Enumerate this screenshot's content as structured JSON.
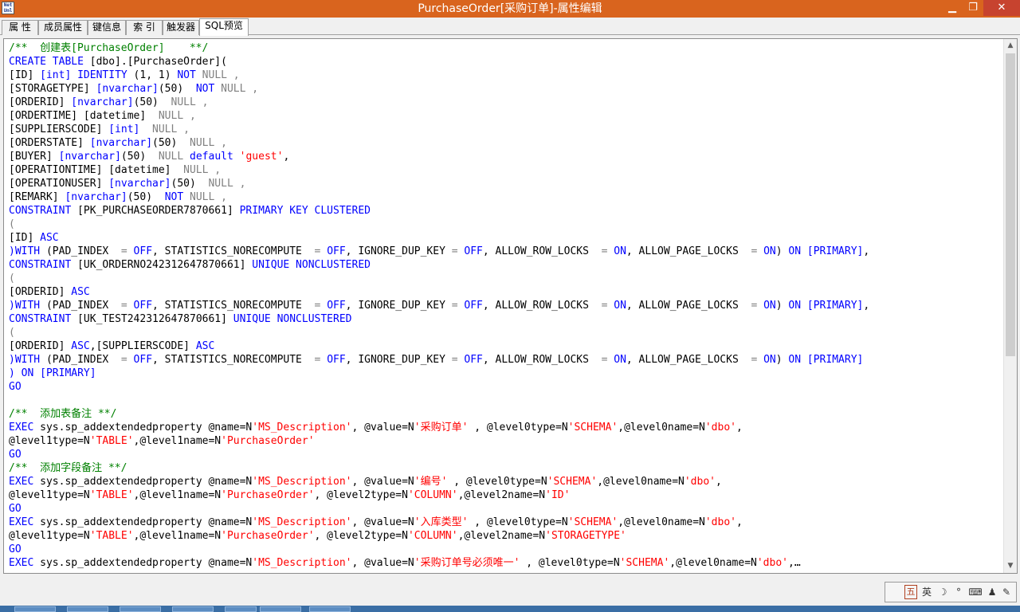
{
  "window": {
    "title": "PurchaseOrder[采购订单]-属性编辑",
    "app_icon_text": "Net Uml",
    "minimize_glyph": "▁",
    "maximize_glyph": "❐",
    "close_glyph": "✕"
  },
  "tabs": [
    {
      "label": "属 性"
    },
    {
      "label": "成员属性"
    },
    {
      "label": "键信息"
    },
    {
      "label": "索 引"
    },
    {
      "label": "触发器"
    },
    {
      "label": "SQL预览",
      "active": true
    }
  ],
  "colors": {
    "titlebar": "#d9641e",
    "comment": "#008000",
    "keyword": "#0000ff",
    "null_gray": "#808080",
    "string": "#ff0000"
  },
  "editor": {
    "lines": [
      [
        [
          "c",
          "/**  创建表[PurchaseOrder]    **/"
        ]
      ],
      [
        [
          "k",
          "CREATE TABLE"
        ],
        [
          "p",
          " [dbo].[PurchaseOrder]("
        ]
      ],
      [
        [
          "p",
          "[ID] "
        ],
        [
          "k",
          "[int]"
        ],
        [
          "p",
          " "
        ],
        [
          "k",
          "IDENTITY"
        ],
        [
          "p",
          " (1, 1) "
        ],
        [
          "k",
          "NOT"
        ],
        [
          "p",
          " "
        ],
        [
          "g",
          "NULL ,"
        ]
      ],
      [
        [
          "p",
          "[STORAGETYPE] "
        ],
        [
          "k",
          "[nvarchar]"
        ],
        [
          "p",
          "(50)  "
        ],
        [
          "k",
          "NOT"
        ],
        [
          "p",
          " "
        ],
        [
          "g",
          "NULL ,"
        ]
      ],
      [
        [
          "p",
          "[ORDERID] "
        ],
        [
          "k",
          "[nvarchar]"
        ],
        [
          "p",
          "(50)  "
        ],
        [
          "g",
          "NULL ,"
        ]
      ],
      [
        [
          "p",
          "[ORDERTIME] [datetime]  "
        ],
        [
          "g",
          "NULL ,"
        ]
      ],
      [
        [
          "p",
          "[SUPPLIERSCODE] "
        ],
        [
          "k",
          "[int]"
        ],
        [
          "p",
          "  "
        ],
        [
          "g",
          "NULL ,"
        ]
      ],
      [
        [
          "p",
          "[ORDERSTATE] "
        ],
        [
          "k",
          "[nvarchar]"
        ],
        [
          "p",
          "(50)  "
        ],
        [
          "g",
          "NULL ,"
        ]
      ],
      [
        [
          "p",
          "[BUYER] "
        ],
        [
          "k",
          "[nvarchar]"
        ],
        [
          "p",
          "(50)  "
        ],
        [
          "g",
          "NULL"
        ],
        [
          "p",
          " "
        ],
        [
          "k",
          "default"
        ],
        [
          "p",
          " "
        ],
        [
          "s",
          "'guest'"
        ],
        [
          "p",
          ","
        ]
      ],
      [
        [
          "p",
          "[OPERATIONTIME] [datetime]  "
        ],
        [
          "g",
          "NULL ,"
        ]
      ],
      [
        [
          "p",
          "[OPERATIONUSER] "
        ],
        [
          "k",
          "[nvarchar]"
        ],
        [
          "p",
          "(50)  "
        ],
        [
          "g",
          "NULL ,"
        ]
      ],
      [
        [
          "p",
          "[REMARK] "
        ],
        [
          "k",
          "[nvarchar]"
        ],
        [
          "p",
          "(50)  "
        ],
        [
          "k",
          "NOT"
        ],
        [
          "p",
          " "
        ],
        [
          "g",
          "NULL ,"
        ]
      ],
      [
        [
          "k",
          "CONSTRAINT"
        ],
        [
          "p",
          " [PK_PURCHASEORDER7870661] "
        ],
        [
          "k",
          "PRIMARY KEY CLUSTERED"
        ]
      ],
      [
        [
          "g",
          "("
        ]
      ],
      [
        [
          "p",
          "[ID] "
        ],
        [
          "k",
          "ASC"
        ]
      ],
      [
        [
          "k",
          ")WITH"
        ],
        [
          "p",
          " (PAD_INDEX  "
        ],
        [
          "g",
          "="
        ],
        [
          "p",
          " "
        ],
        [
          "k",
          "OFF"
        ],
        [
          "p",
          ", STATISTICS_NORECOMPUTE  "
        ],
        [
          "g",
          "="
        ],
        [
          "p",
          " "
        ],
        [
          "k",
          "OFF"
        ],
        [
          "p",
          ", IGNORE_DUP_KEY "
        ],
        [
          "g",
          "="
        ],
        [
          "p",
          " "
        ],
        [
          "k",
          "OFF"
        ],
        [
          "p",
          ", ALLOW_ROW_LOCKS  "
        ],
        [
          "g",
          "="
        ],
        [
          "p",
          " "
        ],
        [
          "k",
          "ON"
        ],
        [
          "p",
          ", ALLOW_PAGE_LOCKS  "
        ],
        [
          "g",
          "="
        ],
        [
          "p",
          " "
        ],
        [
          "k",
          "ON"
        ],
        [
          "p",
          ") "
        ],
        [
          "k",
          "ON"
        ],
        [
          "p",
          " "
        ],
        [
          "k",
          "[PRIMARY]"
        ],
        [
          "p",
          ","
        ]
      ],
      [
        [
          "k",
          "CONSTRAINT"
        ],
        [
          "p",
          " [UK_ORDERNO242312647870661] "
        ],
        [
          "k",
          "UNIQUE NONCLUSTERED"
        ]
      ],
      [
        [
          "g",
          "("
        ]
      ],
      [
        [
          "p",
          "[ORDERID] "
        ],
        [
          "k",
          "ASC"
        ]
      ],
      [
        [
          "k",
          ")WITH"
        ],
        [
          "p",
          " (PAD_INDEX  "
        ],
        [
          "g",
          "="
        ],
        [
          "p",
          " "
        ],
        [
          "k",
          "OFF"
        ],
        [
          "p",
          ", STATISTICS_NORECOMPUTE  "
        ],
        [
          "g",
          "="
        ],
        [
          "p",
          " "
        ],
        [
          "k",
          "OFF"
        ],
        [
          "p",
          ", IGNORE_DUP_KEY "
        ],
        [
          "g",
          "="
        ],
        [
          "p",
          " "
        ],
        [
          "k",
          "OFF"
        ],
        [
          "p",
          ", ALLOW_ROW_LOCKS  "
        ],
        [
          "g",
          "="
        ],
        [
          "p",
          " "
        ],
        [
          "k",
          "ON"
        ],
        [
          "p",
          ", ALLOW_PAGE_LOCKS  "
        ],
        [
          "g",
          "="
        ],
        [
          "p",
          " "
        ],
        [
          "k",
          "ON"
        ],
        [
          "p",
          ") "
        ],
        [
          "k",
          "ON"
        ],
        [
          "p",
          " "
        ],
        [
          "k",
          "[PRIMARY]"
        ],
        [
          "p",
          ","
        ]
      ],
      [
        [
          "k",
          "CONSTRAINT"
        ],
        [
          "p",
          " [UK_TEST242312647870661] "
        ],
        [
          "k",
          "UNIQUE NONCLUSTERED"
        ]
      ],
      [
        [
          "g",
          "("
        ]
      ],
      [
        [
          "p",
          "[ORDERID] "
        ],
        [
          "k",
          "ASC"
        ],
        [
          "p",
          ",[SUPPLIERSCODE] "
        ],
        [
          "k",
          "ASC"
        ]
      ],
      [
        [
          "k",
          ")WITH"
        ],
        [
          "p",
          " (PAD_INDEX  "
        ],
        [
          "g",
          "="
        ],
        [
          "p",
          " "
        ],
        [
          "k",
          "OFF"
        ],
        [
          "p",
          ", STATISTICS_NORECOMPUTE  "
        ],
        [
          "g",
          "="
        ],
        [
          "p",
          " "
        ],
        [
          "k",
          "OFF"
        ],
        [
          "p",
          ", IGNORE_DUP_KEY "
        ],
        [
          "g",
          "="
        ],
        [
          "p",
          " "
        ],
        [
          "k",
          "OFF"
        ],
        [
          "p",
          ", ALLOW_ROW_LOCKS  "
        ],
        [
          "g",
          "="
        ],
        [
          "p",
          " "
        ],
        [
          "k",
          "ON"
        ],
        [
          "p",
          ", ALLOW_PAGE_LOCKS  "
        ],
        [
          "g",
          "="
        ],
        [
          "p",
          " "
        ],
        [
          "k",
          "ON"
        ],
        [
          "p",
          ") "
        ],
        [
          "k",
          "ON"
        ],
        [
          "p",
          " "
        ],
        [
          "k",
          "[PRIMARY]"
        ]
      ],
      [
        [
          "k",
          ")"
        ],
        [
          "p",
          " "
        ],
        [
          "k",
          "ON"
        ],
        [
          "p",
          " "
        ],
        [
          "k",
          "[PRIMARY]"
        ]
      ],
      [
        [
          "k",
          "GO"
        ]
      ],
      [
        [
          "p",
          ""
        ]
      ],
      [
        [
          "c",
          "/**  添加表备注 **/"
        ]
      ],
      [
        [
          "k",
          "EXEC"
        ],
        [
          "p",
          " sys.sp_addextendedproperty @name=N"
        ],
        [
          "s",
          "'MS_Description'"
        ],
        [
          "p",
          ", @value=N"
        ],
        [
          "s",
          "'采购订单'"
        ],
        [
          "p",
          " , @level0type=N"
        ],
        [
          "s",
          "'SCHEMA'"
        ],
        [
          "p",
          ",@level0name=N"
        ],
        [
          "s",
          "'dbo'"
        ],
        [
          "p",
          ","
        ]
      ],
      [
        [
          "p",
          "@level1type=N"
        ],
        [
          "s",
          "'TABLE'"
        ],
        [
          "p",
          ",@level1name=N"
        ],
        [
          "s",
          "'PurchaseOrder'"
        ]
      ],
      [
        [
          "k",
          "GO"
        ]
      ],
      [
        [
          "c",
          "/**  添加字段备注 **/"
        ]
      ],
      [
        [
          "k",
          "EXEC"
        ],
        [
          "p",
          " sys.sp_addextendedproperty @name=N"
        ],
        [
          "s",
          "'MS_Description'"
        ],
        [
          "p",
          ", @value=N"
        ],
        [
          "s",
          "'编号'"
        ],
        [
          "p",
          " , @level0type=N"
        ],
        [
          "s",
          "'SCHEMA'"
        ],
        [
          "p",
          ",@level0name=N"
        ],
        [
          "s",
          "'dbo'"
        ],
        [
          "p",
          ","
        ]
      ],
      [
        [
          "p",
          "@level1type=N"
        ],
        [
          "s",
          "'TABLE'"
        ],
        [
          "p",
          ",@level1name=N"
        ],
        [
          "s",
          "'PurchaseOrder'"
        ],
        [
          "p",
          ", @level2type=N"
        ],
        [
          "s",
          "'COLUMN'"
        ],
        [
          "p",
          ",@level2name=N"
        ],
        [
          "s",
          "'ID'"
        ]
      ],
      [
        [
          "k",
          "GO"
        ]
      ],
      [
        [
          "k",
          "EXEC"
        ],
        [
          "p",
          " sys.sp_addextendedproperty @name=N"
        ],
        [
          "s",
          "'MS_Description'"
        ],
        [
          "p",
          ", @value=N"
        ],
        [
          "s",
          "'入库类型'"
        ],
        [
          "p",
          " , @level0type=N"
        ],
        [
          "s",
          "'SCHEMA'"
        ],
        [
          "p",
          ",@level0name=N"
        ],
        [
          "s",
          "'dbo'"
        ],
        [
          "p",
          ","
        ]
      ],
      [
        [
          "p",
          "@level1type=N"
        ],
        [
          "s",
          "'TABLE'"
        ],
        [
          "p",
          ",@level1name=N"
        ],
        [
          "s",
          "'PurchaseOrder'"
        ],
        [
          "p",
          ", @level2type=N"
        ],
        [
          "s",
          "'COLUMN'"
        ],
        [
          "p",
          ",@level2name=N"
        ],
        [
          "s",
          "'STORAGETYPE'"
        ]
      ],
      [
        [
          "k",
          "GO"
        ]
      ],
      [
        [
          "k",
          "EXEC"
        ],
        [
          "p",
          " sys.sp_addextendedproperty @name=N"
        ],
        [
          "s",
          "'MS_Description'"
        ],
        [
          "p",
          ", @value=N"
        ],
        [
          "s",
          "'采购订单号必须唯一'"
        ],
        [
          "p",
          " , @level0type=N"
        ],
        [
          "s",
          "'SCHEMA'"
        ],
        [
          "p",
          ",@level0name=N"
        ],
        [
          "s",
          "'dbo'"
        ],
        [
          "p",
          ",…"
        ]
      ]
    ]
  },
  "ime_toolbar": {
    "logo": "五",
    "lang": "英",
    "moon_icon": "☽",
    "punct": "°",
    "keyboard_icon": "⌨",
    "user_icon": "♟",
    "tool_icon": "✎"
  }
}
